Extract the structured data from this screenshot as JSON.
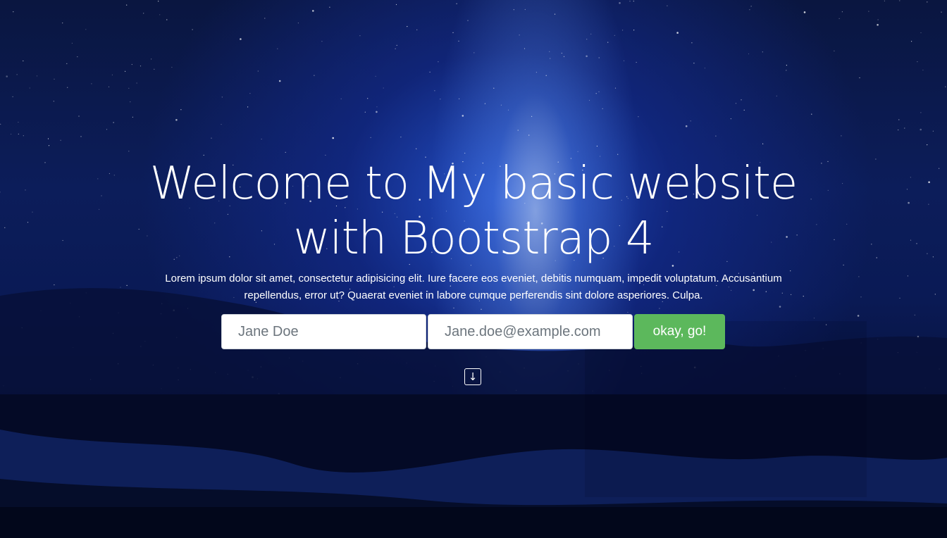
{
  "hero": {
    "title": "Welcome to My basic website with Bootstrap 4",
    "lead": "Lorem ipsum dolor sit amet, consectetur adipisicing elit. Iure facere eos eveniet, debitis numquam, impedit voluptatum. Accusantium repellendus, error ut? Quaerat eveniet in labore cumque perferendis sint dolore asperiores. Culpa."
  },
  "form": {
    "name_placeholder": "Jane Doe",
    "email_placeholder": "Jane.doe@example.com",
    "submit_label": "okay, go!"
  },
  "scroll": {
    "icon": "arrow-down-icon",
    "glyph": "↓"
  },
  "colors": {
    "accent_button": "#5cb85c",
    "background": "#0c1d5a"
  }
}
